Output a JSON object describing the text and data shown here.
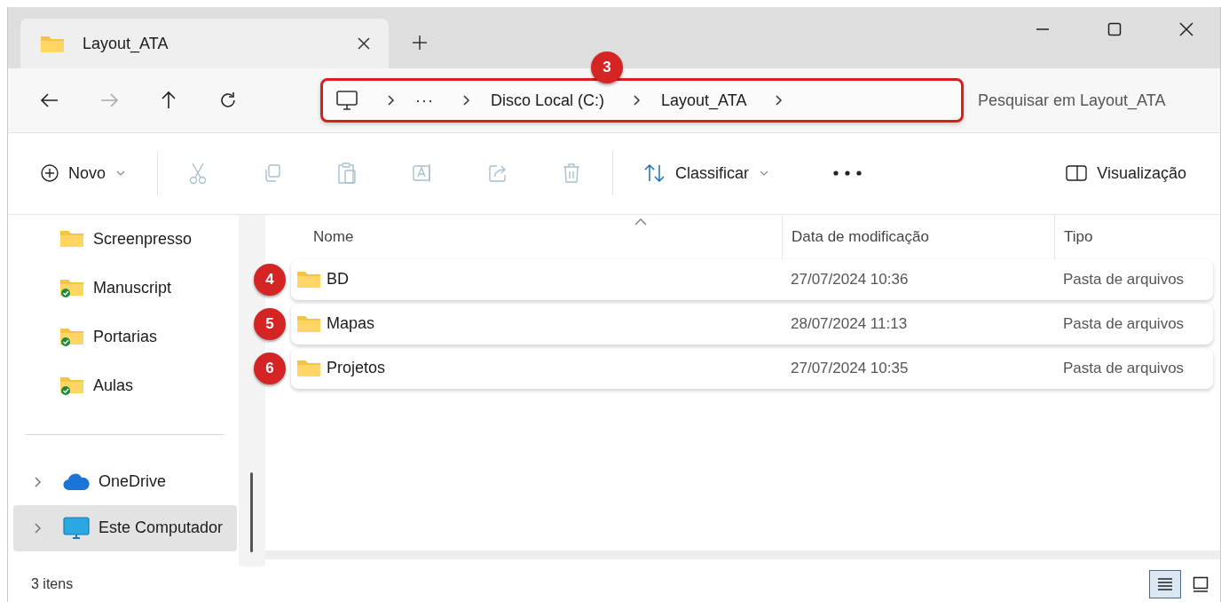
{
  "tab": {
    "title": "Layout_ATA",
    "selected": true
  },
  "nav_buttons": [
    {
      "kind": "back",
      "disabled": false
    },
    {
      "kind": "forward",
      "disabled": true
    },
    {
      "kind": "up",
      "disabled": false
    },
    {
      "kind": "refresh",
      "disabled": false
    }
  ],
  "address_bar": {
    "callout": "3",
    "segments": [
      {
        "kind": "overflow",
        "label": "···"
      },
      {
        "kind": "folder",
        "label": "Disco Local (C:)"
      },
      {
        "kind": "folder",
        "label": "Layout_ATA"
      }
    ]
  },
  "search": {
    "placeholder": "Pesquisar em Layout_ATA"
  },
  "toolbar": [
    {
      "kind": "new",
      "label": "Novo",
      "dropdown": true,
      "disabled": false
    },
    {
      "kind": "cut",
      "disabled": true
    },
    {
      "kind": "copy",
      "disabled": true
    },
    {
      "kind": "paste",
      "disabled": true
    },
    {
      "kind": "rename",
      "disabled": true
    },
    {
      "kind": "share",
      "disabled": true
    },
    {
      "kind": "delete",
      "disabled": true
    },
    {
      "kind": "sort",
      "label": "Classificar",
      "dropdown": true,
      "disabled": false
    },
    {
      "kind": "more",
      "disabled": false
    },
    {
      "kind": "preview",
      "label": "Visualização",
      "disabled": false
    }
  ],
  "sidebar": {
    "items": [
      {
        "label": "Screenpresso",
        "kind": "folder",
        "selected": false
      },
      {
        "label": "Manuscript",
        "kind": "synced-folder",
        "selected": false
      },
      {
        "label": "Portarias",
        "kind": "synced-folder",
        "selected": false
      },
      {
        "label": "Aulas",
        "kind": "synced-folder",
        "selected": false
      }
    ],
    "locations": [
      {
        "label": "OneDrive",
        "kind": "cloud",
        "expanded": false,
        "selected": false
      },
      {
        "label": "Este Computador",
        "kind": "computer",
        "expanded": false,
        "selected": true
      }
    ]
  },
  "table": {
    "columns": [
      "Nome",
      "Data de modificação",
      "Tipo"
    ],
    "rows": [
      {
        "name": "BD",
        "date": "27/07/2024 10:36",
        "type": "Pasta de arquivos",
        "callout": "4"
      },
      {
        "name": "Mapas",
        "date": "28/07/2024 11:13",
        "type": "Pasta de arquivos",
        "callout": "5"
      },
      {
        "name": "Projetos",
        "date": "27/07/2024 10:35",
        "type": "Pasta de arquivos",
        "callout": "6"
      }
    ]
  },
  "status_bar": {
    "count": "3 itens",
    "views": [
      {
        "kind": "details",
        "selected": true
      },
      {
        "kind": "tiles",
        "selected": false
      }
    ]
  }
}
